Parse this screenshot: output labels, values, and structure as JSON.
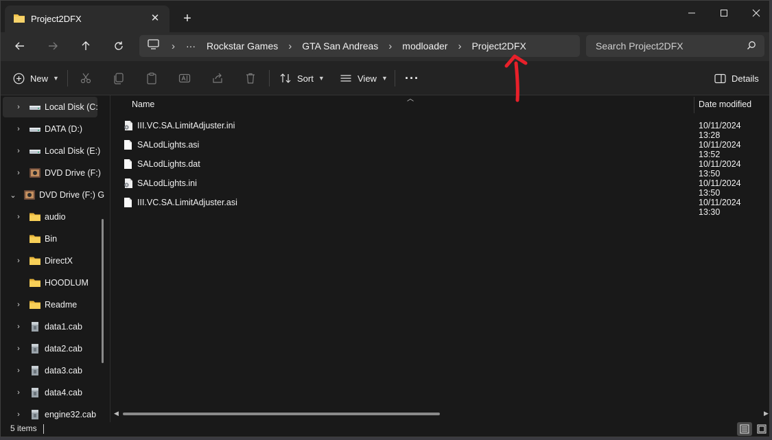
{
  "window": {
    "tab_title": "Project2DFX",
    "tab_close": "✕",
    "new_tab": "+"
  },
  "address": {
    "crumbs": [
      "Rockstar Games",
      "GTA San Andreas",
      "modloader",
      "Project2DFX"
    ],
    "separator": "›",
    "overflow": "···"
  },
  "search": {
    "placeholder": "Search Project2DFX"
  },
  "toolbar": {
    "new_label": "New",
    "sort_label": "Sort",
    "view_label": "View",
    "details_label": "Details",
    "more_label": "···"
  },
  "nav": {
    "items": [
      {
        "label": "Local Disk (C:)",
        "icon": "drive-icon"
      },
      {
        "label": "DATA (D:)",
        "icon": "drive-icon"
      },
      {
        "label": "Local Disk (E:)",
        "icon": "drive-icon"
      },
      {
        "label": "DVD Drive (F:)",
        "icon": "dvd-icon"
      },
      {
        "label": "DVD Drive (F:) G",
        "icon": "dvd-icon"
      },
      {
        "label": "audio",
        "icon": "folder-icon"
      },
      {
        "label": "Bin",
        "icon": "folder-icon"
      },
      {
        "label": "DirectX",
        "icon": "folder-icon"
      },
      {
        "label": "HOODLUM",
        "icon": "folder-icon"
      },
      {
        "label": "Readme",
        "icon": "folder-icon"
      },
      {
        "label": "data1.cab",
        "icon": "cab-icon"
      },
      {
        "label": "data2.cab",
        "icon": "cab-icon"
      },
      {
        "label": "data3.cab",
        "icon": "cab-icon"
      },
      {
        "label": "data4.cab",
        "icon": "cab-icon"
      },
      {
        "label": "engine32.cab",
        "icon": "cab-icon"
      }
    ]
  },
  "files": {
    "columns": {
      "name": "Name",
      "date": "Date modified"
    },
    "rows": [
      {
        "name": "III.VC.SA.LimitAdjuster.ini",
        "date": "10/11/2024 13:28",
        "icon": "ini-file-icon"
      },
      {
        "name": "SALodLights.asi",
        "date": "10/11/2024 13:52",
        "icon": "file-icon"
      },
      {
        "name": "SALodLights.dat",
        "date": "10/11/2024 13:50",
        "icon": "file-icon"
      },
      {
        "name": "SALodLights.ini",
        "date": "10/11/2024 13:50",
        "icon": "ini-file-icon"
      },
      {
        "name": "III.VC.SA.LimitAdjuster.asi",
        "date": "10/11/2024 13:30",
        "icon": "file-icon"
      }
    ]
  },
  "status": {
    "item_count": "5 items"
  },
  "colors": {
    "folder": "#f0c24b",
    "annotation": "#e8202a",
    "window_bg": "#191919"
  }
}
